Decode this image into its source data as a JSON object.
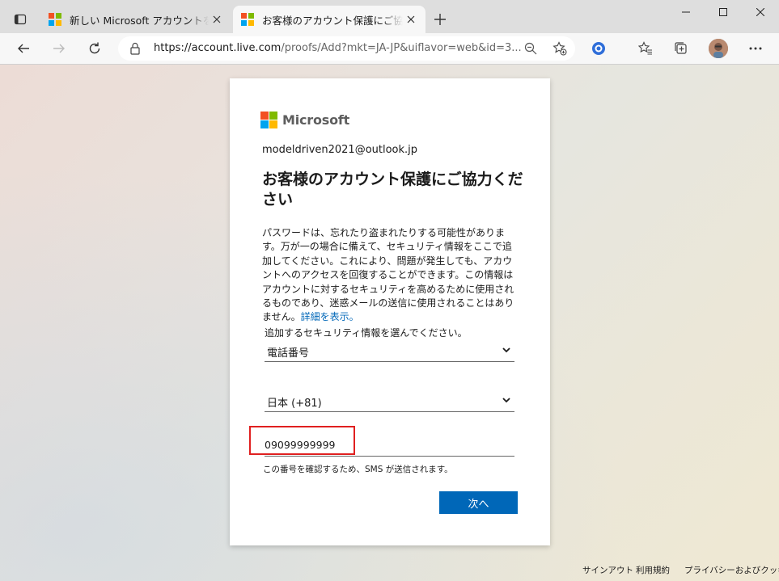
{
  "browser": {
    "tabs": [
      {
        "title": "新しい Microsoft アカウントを作成する",
        "active": false
      },
      {
        "title": "お客様のアカウント保護にご協力ください",
        "active": true
      }
    ],
    "address": {
      "url_host": "https://account.live.com",
      "url_path": "/proofs/Add?mkt=JA-JP&uiflavor=web&id=3..."
    }
  },
  "page": {
    "brand": "Microsoft",
    "email": "modeldriven2021@outlook.jp",
    "heading": "お客様のアカウント保護にご協力ください",
    "description": "パスワードは、忘れたり盗まれたりする可能性があります。万が一の場合に備えて、セキュリティ情報をここで追加してください。これにより、問題が発生しても、アカウントへのアクセスを回復することができます。この情報はアカウントに対するセキュリティを高めるために使用されるものであり、迷惑メールの送信に使用されることはありません。",
    "details_link": "詳細を表示。",
    "select_label": "追加するセキュリティ情報を選んでください。",
    "method_select": "電話番号",
    "country_select": "日本 (+81)",
    "phone_value": "09099999999",
    "sms_note": "この番号を確認するため、SMS が送信されます。",
    "next_button": "次へ"
  },
  "footer": {
    "signout": "サインアウト",
    "terms": "利用規約",
    "privacy": "プライバシーおよびクッキー"
  },
  "colors": {
    "accent": "#0067b8",
    "highlight": "#e02020"
  }
}
